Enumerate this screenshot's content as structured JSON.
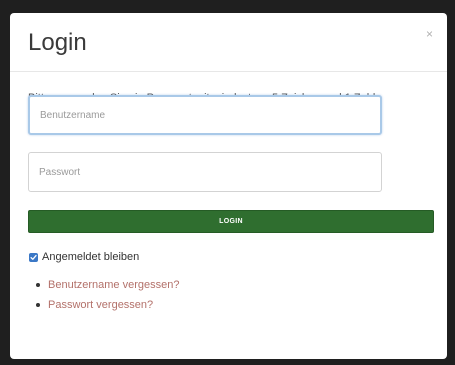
{
  "modal": {
    "title": "Login",
    "close_label": "×",
    "hint": "Bitte verwenden Sie ein Passwort mit mindestens 5 Zeichen und 1 Zahl",
    "username_placeholder": "Benutzername",
    "password_placeholder": "Passwort",
    "login_label": "LOGIN",
    "remember_label": "Angemeldet bleiben",
    "remember_checked": true,
    "links": [
      {
        "label": "Benutzername vergessen?"
      },
      {
        "label": "Passwort vergessen?"
      }
    ]
  },
  "colors": {
    "accent_green": "#2f6e2f",
    "link_color": "#b3716a",
    "checkbox_blue": "#3b78c6"
  }
}
